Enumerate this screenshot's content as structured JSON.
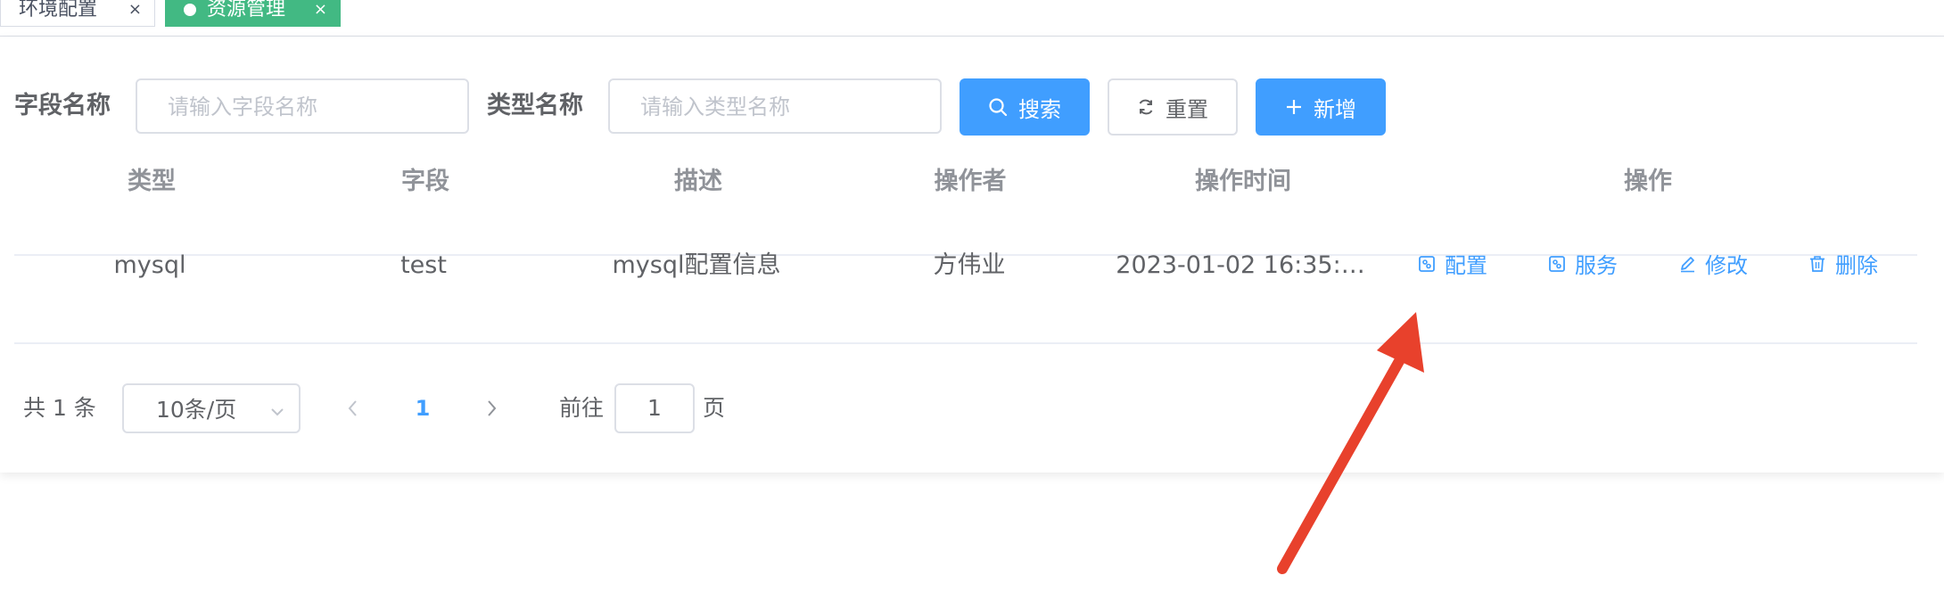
{
  "tabs": [
    {
      "label": "环境配置",
      "close": "×",
      "active": false
    },
    {
      "label": "资源管理",
      "close": "×",
      "active": true
    }
  ],
  "search_form": {
    "field_name_label": "字段名称",
    "field_name_placeholder": "请输入字段名称",
    "type_name_label": "类型名称",
    "type_name_placeholder": "请输入类型名称",
    "search_button": "搜索",
    "reset_button": "重置",
    "add_button": "新增"
  },
  "table": {
    "columns": [
      "类型",
      "字段",
      "描述",
      "操作者",
      "操作时间",
      "操作"
    ],
    "rows": [
      {
        "type": "mysql",
        "field": "test",
        "description": "mysql配置信息",
        "operator": "方伟业",
        "time": "2023-01-02 16:35:…",
        "actions": [
          "配置",
          "服务",
          "修改",
          "删除"
        ]
      }
    ]
  },
  "pagination": {
    "total_text": "共 1 条",
    "page_size": "10条/页",
    "current_page": "1",
    "goto_prefix": "前往",
    "goto_value": "1",
    "goto_suffix": "页"
  },
  "colors": {
    "primary": "#409eff",
    "active_tab": "#42b983",
    "annotation_arrow": "#e8412c"
  }
}
